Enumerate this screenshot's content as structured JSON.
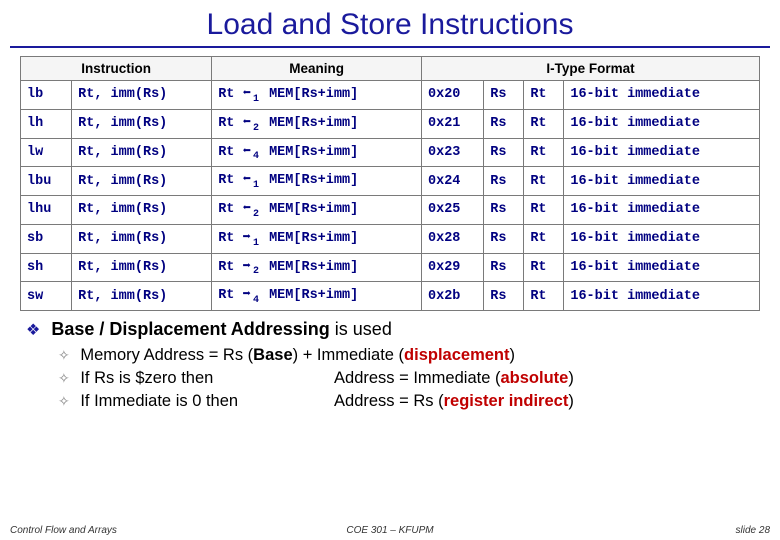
{
  "title": "Load and Store Instructions",
  "table": {
    "headers": [
      "Instruction",
      "Meaning",
      "I-Type Format"
    ],
    "rows": [
      {
        "op": "lb",
        "args": "Rt, imm(Rs)",
        "dir": "left",
        "sub": "1",
        "opcode": "0x20",
        "rs": "Rs",
        "rt": "Rt",
        "imm": "16-bit immediate"
      },
      {
        "op": "lh",
        "args": "Rt, imm(Rs)",
        "dir": "left",
        "sub": "2",
        "opcode": "0x21",
        "rs": "Rs",
        "rt": "Rt",
        "imm": "16-bit immediate"
      },
      {
        "op": "lw",
        "args": "Rt, imm(Rs)",
        "dir": "left",
        "sub": "4",
        "opcode": "0x23",
        "rs": "Rs",
        "rt": "Rt",
        "imm": "16-bit immediate"
      },
      {
        "op": "lbu",
        "args": "Rt, imm(Rs)",
        "dir": "left",
        "sub": "1",
        "opcode": "0x24",
        "rs": "Rs",
        "rt": "Rt",
        "imm": "16-bit immediate"
      },
      {
        "op": "lhu",
        "args": "Rt, imm(Rs)",
        "dir": "left",
        "sub": "2",
        "opcode": "0x25",
        "rs": "Rs",
        "rt": "Rt",
        "imm": "16-bit immediate"
      },
      {
        "op": "sb",
        "args": "Rt, imm(Rs)",
        "dir": "right",
        "sub": "1",
        "opcode": "0x28",
        "rs": "Rs",
        "rt": "Rt",
        "imm": "16-bit immediate"
      },
      {
        "op": "sh",
        "args": "Rt, imm(Rs)",
        "dir": "right",
        "sub": "2",
        "opcode": "0x29",
        "rs": "Rs",
        "rt": "Rt",
        "imm": "16-bit immediate"
      },
      {
        "op": "sw",
        "args": "Rt, imm(Rs)",
        "dir": "right",
        "sub": "4",
        "opcode": "0x2b",
        "rs": "Rs",
        "rt": "Rt",
        "imm": "16-bit immediate"
      }
    ],
    "meaning_prefix": "Rt",
    "meaning_suffix": "MEM[Rs+imm]"
  },
  "bullet1": {
    "pre": "Base / Displacement Addressing",
    "post": " is used"
  },
  "sub1": {
    "pre": "Memory Address = Rs (",
    "b": "Base",
    "mid": ") + Immediate (",
    "d": "displacement",
    "post": ")"
  },
  "sub2": {
    "if": "If Rs is $zero then",
    "addr_pre": "Address = Immediate (",
    "kw": "absolute",
    "post": ")"
  },
  "sub3": {
    "if": "If Immediate is 0 then",
    "addr_pre": "Address = Rs (",
    "kw": "register indirect",
    "post": ")"
  },
  "footer": {
    "left": "Control Flow and Arrays",
    "center": "COE 301 – KFUPM",
    "right": "slide 28"
  }
}
